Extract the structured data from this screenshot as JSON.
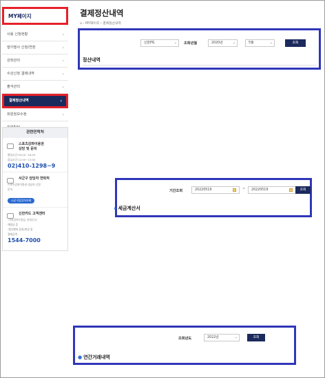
{
  "sidebar": {
    "title": "MY페이지",
    "items": [
      {
        "label": "사용 신청현황",
        "active": false
      },
      {
        "label": "행가행사 신청/연장",
        "active": false
      },
      {
        "label": "강좌관리",
        "active": false
      },
      {
        "label": "수강신청 결제내역",
        "active": false
      },
      {
        "label": "출석관리",
        "active": false
      },
      {
        "label": "결제정산내역",
        "active": true
      },
      {
        "label": "회원정보수정",
        "active": false
      },
      {
        "label": "회원탈퇴",
        "active": false
      }
    ],
    "related": {
      "title": "관련연락처",
      "s1_head1": "스포츠강좌이용권",
      "s1_head2": "상담 및 문의",
      "s1_hours1": "평일시간:09:00~18:00",
      "s1_hours2": "점심시간:12:00~13:00",
      "s1_phone": "02)410-1298~9",
      "s2_head": "서군구 담당자 연락처",
      "s2_sub1": "스포츠강좌이용권 대상자 선정",
      "s2_sub2": "문의",
      "s2_btn": "시군구담당자조회",
      "s3_head": "신한카드 고객센터",
      "s3_sub1": "-이용권카드발급, 분실신고,",
      "s3_sub2": "재발급 등",
      "s3_sub3": "-행가행위 등록/변경 및",
      "s3_sub4": "결제금액",
      "s3_phone": "1544-7000"
    }
  },
  "main": {
    "title": "결제정산내역",
    "breadcrumb": "⌂ › MY페이지 › 결제정산내역",
    "settlement": {
      "bank_select": "신한PG",
      "year_label": "조회년월",
      "year_select": "2020년",
      "month_select": "5월",
      "search_btn": "조회",
      "section_title": "정산내역"
    },
    "tax": {
      "period_label": "기간조회",
      "date_from": "20220519",
      "tilde": "~",
      "date_to": "20220519",
      "search_btn": "조회",
      "section_title": "세금계산서"
    },
    "annual": {
      "year_label": "조회년도",
      "year_select": "2022년",
      "search_btn": "조회",
      "section_title": "연간거래내역"
    }
  }
}
